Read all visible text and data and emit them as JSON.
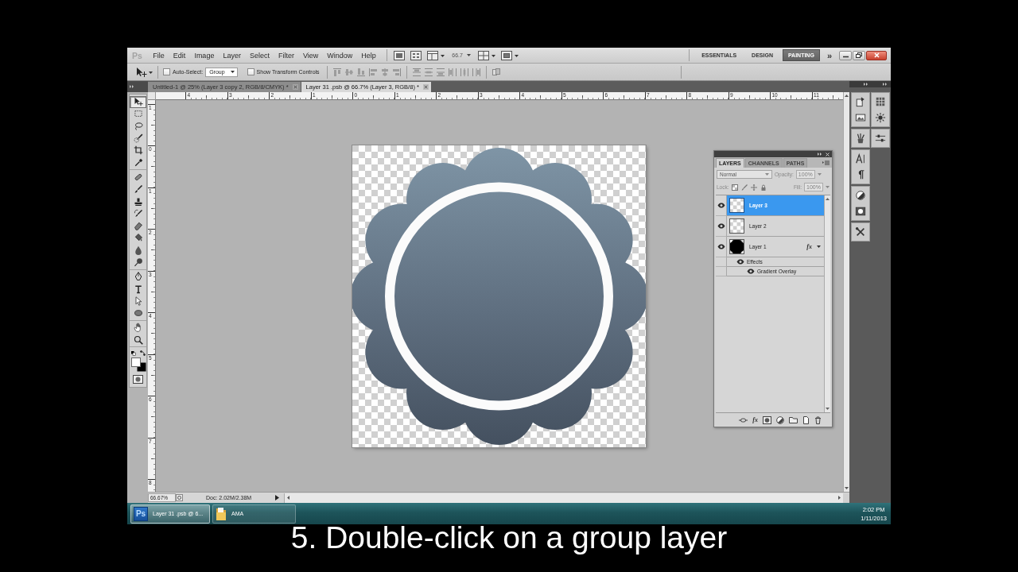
{
  "menu_bar": {
    "logo": "Ps",
    "menus": [
      "File",
      "Edit",
      "Image",
      "Layer",
      "Select",
      "Filter",
      "View",
      "Window",
      "Help"
    ],
    "zoom": "66.7",
    "workspaces": [
      {
        "label": "ESSENTIALS",
        "selected": false
      },
      {
        "label": "DESIGN",
        "selected": false
      },
      {
        "label": "PAINTING",
        "selected": true
      }
    ],
    "more": "»"
  },
  "options_bar": {
    "auto_select": {
      "label": "Auto-Select:",
      "checked": false
    },
    "auto_select_target": "Group",
    "transform_controls": {
      "label": "Show Transform Controls",
      "checked": false
    }
  },
  "toolbox": {
    "groups": [
      [
        {
          "kind": "move",
          "selected": true
        },
        {
          "kind": "marquee",
          "selected": false
        },
        {
          "kind": "lasso",
          "selected": false
        },
        {
          "kind": "quick-select",
          "selected": false
        },
        {
          "kind": "crop",
          "selected": false
        },
        {
          "kind": "eyedropper",
          "selected": false
        }
      ],
      [
        {
          "kind": "healing",
          "selected": false
        },
        {
          "kind": "brush",
          "selected": false
        },
        {
          "kind": "stamp",
          "selected": false
        },
        {
          "kind": "history-brush",
          "selected": false
        },
        {
          "kind": "eraser",
          "selected": false
        },
        {
          "kind": "bucket",
          "selected": false
        },
        {
          "kind": "blur",
          "selected": false
        },
        {
          "kind": "dodge",
          "selected": false
        }
      ],
      [
        {
          "kind": "pen",
          "selected": false
        },
        {
          "kind": "type",
          "selected": false
        },
        {
          "kind": "path-select",
          "selected": false
        },
        {
          "kind": "shape",
          "selected": false
        }
      ],
      [
        {
          "kind": "hand",
          "selected": false
        },
        {
          "kind": "zoom",
          "selected": false
        }
      ]
    ]
  },
  "document_tabs": [
    {
      "label": "Untitled-1 @ 25% (Layer 3 copy 2, RGB/8/CMYK) *",
      "selected": false
    },
    {
      "label": "Layer 31 .psb @ 66.7% (Layer 3, RGB/8) *",
      "selected": true
    }
  ],
  "rulers": {
    "horizontal": [
      "4",
      "3",
      "2",
      "1",
      "0",
      "1",
      "2",
      "3",
      "4",
      "5",
      "6",
      "7",
      "8",
      "9",
      "10",
      "11"
    ],
    "vertical": [
      "1",
      "0",
      "1",
      "2",
      "3",
      "4",
      "5",
      "6",
      "7",
      "8"
    ]
  },
  "status_bar": {
    "zoom": "66.67%",
    "document_info": "Doc: 2.02M/2.38M"
  },
  "layers_panel": {
    "tabs": [
      {
        "label": "LAYERS",
        "selected": true
      },
      {
        "label": "CHANNELS",
        "selected": false
      },
      {
        "label": "PATHS",
        "selected": false
      }
    ],
    "blend_mode": "Normal",
    "opacity_label": "Opacity:",
    "opacity": "100%",
    "lock_label": "Lock:",
    "fill_label": "Fill:",
    "fill": "100%",
    "layers": [
      {
        "name": "Layer 3",
        "selected": true,
        "visible": true,
        "thumbnail": {
          "kind": "transparent"
        }
      },
      {
        "name": "Layer 2",
        "selected": false,
        "visible": true,
        "thumbnail": {
          "kind": "transparent"
        }
      },
      {
        "name": "Layer 1",
        "selected": false,
        "visible": true,
        "thumbnail": {
          "kind": "shape"
        },
        "effects_badge": "fx",
        "expanded": true,
        "children": [
          {
            "name": "Effects",
            "visible": true,
            "children": [
              {
                "name": "Gradient Overlay",
                "visible": true
              }
            ]
          }
        ]
      }
    ],
    "effects_button": "fx"
  },
  "taskbar": {
    "items": [
      {
        "kind": "app",
        "badge": "Ps",
        "label": "Layer 31 .psb @ 6...",
        "selected": true
      },
      {
        "kind": "folder",
        "label": "AMA",
        "selected": false
      }
    ],
    "time": "2:02 PM",
    "date": "1/11/2013"
  },
  "caption": "5. Double-click on a group layer"
}
